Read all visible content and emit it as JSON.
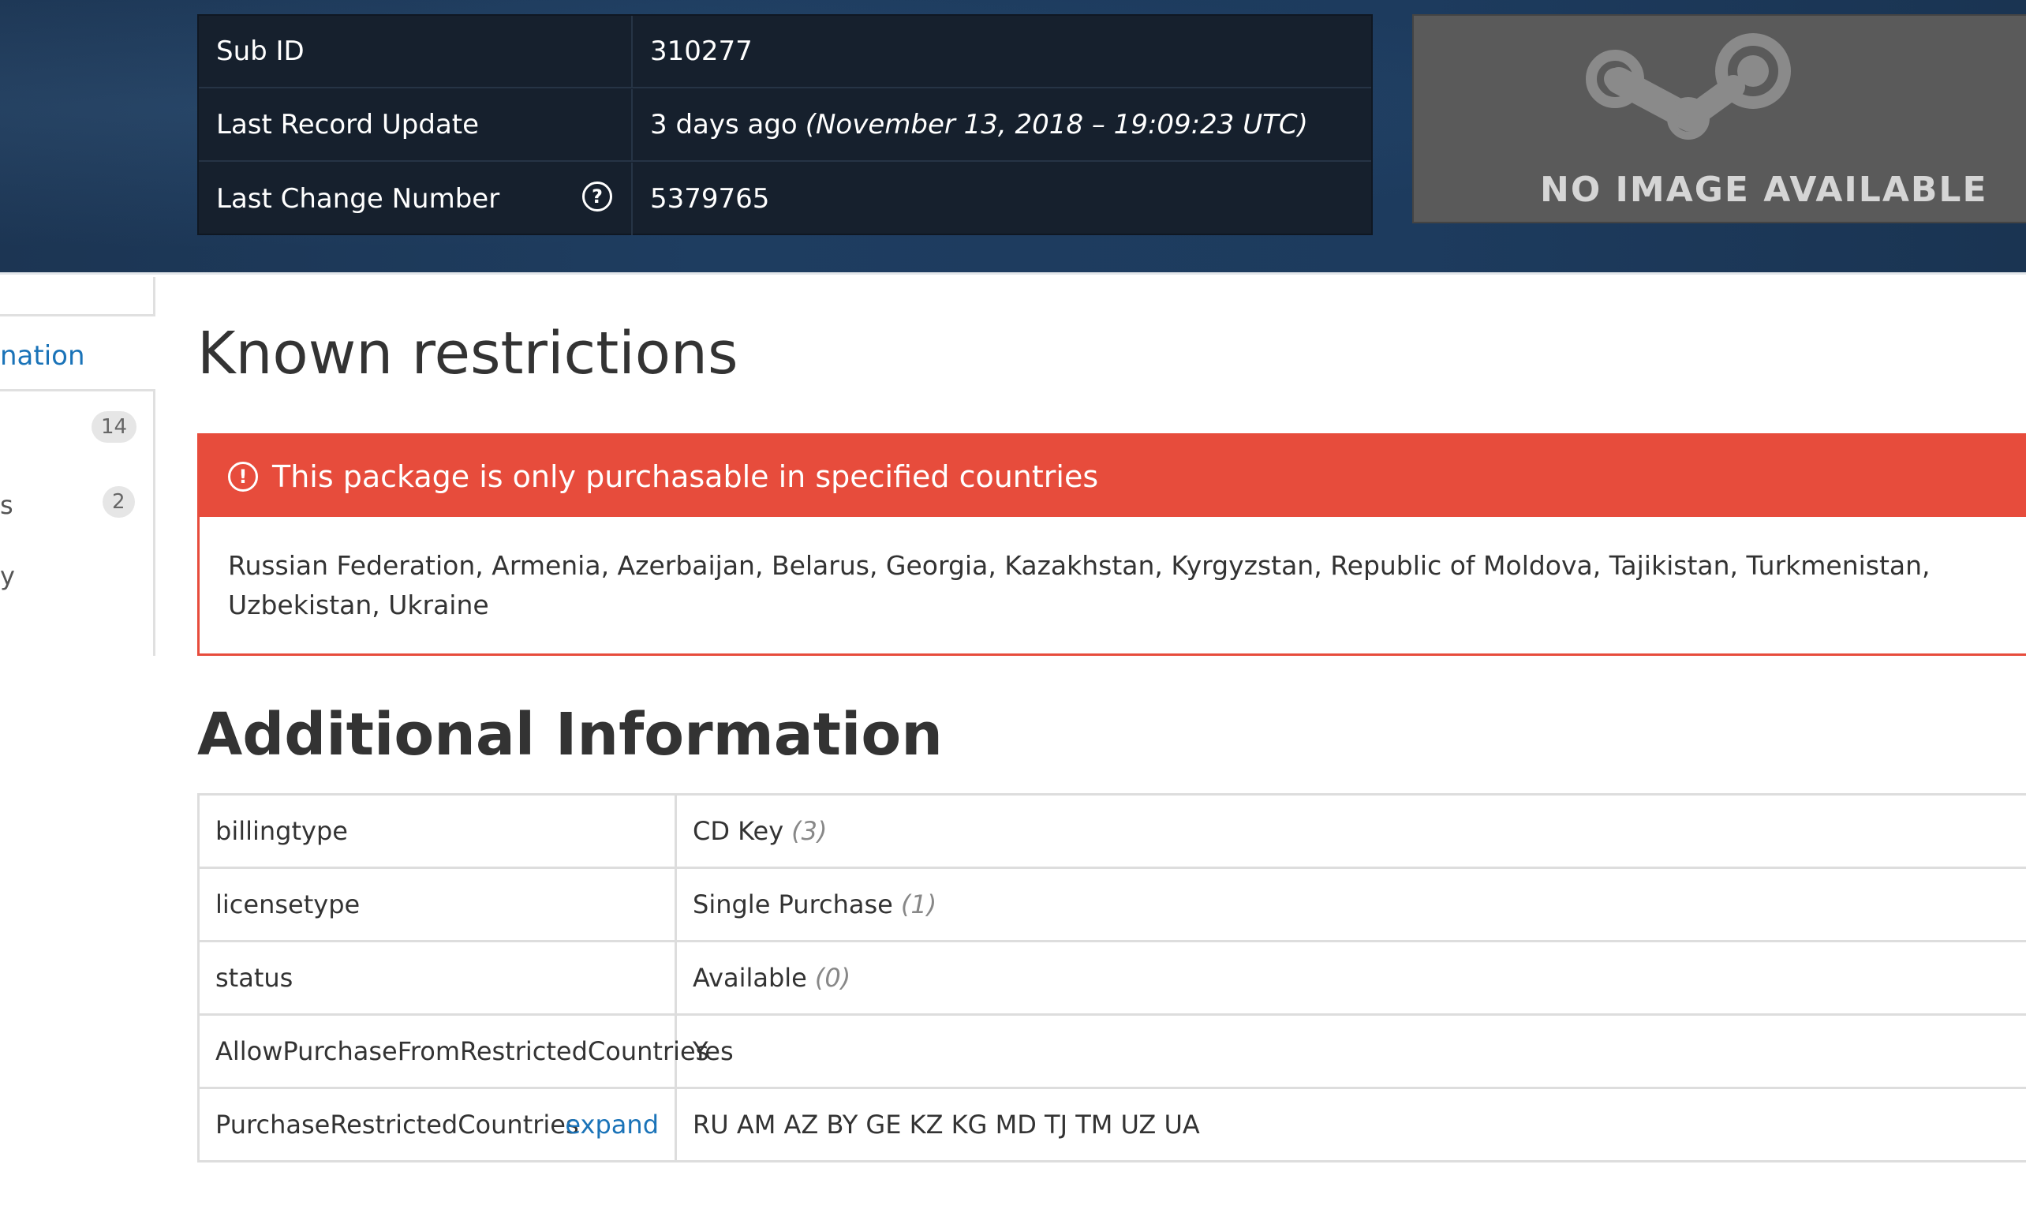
{
  "info": {
    "sub_id_label": "Sub ID",
    "sub_id_value": "310277",
    "last_update_label": "Last Record Update",
    "last_update_value": "3 days ago",
    "last_update_exact": "(November 13, 2018 – 19:09:23 UTC)",
    "last_change_label": "Last Change Number",
    "last_change_value": "5379765"
  },
  "image_placeholder": {
    "text": "NO IMAGE AVAILABLE",
    "logo": "steam-logo"
  },
  "sidebar": {
    "link_fragment": "nation",
    "items": [
      {
        "label": "",
        "count": "14"
      },
      {
        "label": "s",
        "count": "2"
      },
      {
        "label": "y",
        "count": ""
      }
    ]
  },
  "restrictions": {
    "heading": "Known restrictions",
    "alert_title": "This package is only purchasable in specified countries",
    "alert_icon": "exclamation-circle-icon",
    "countries": "Russian Federation, Armenia, Azerbaijan, Belarus, Georgia, Kazakhstan, Kyrgyzstan, Republic of Moldova, Tajikistan, Turkmenistan, Uzbekistan, Ukraine"
  },
  "additional": {
    "heading": "Additional Information",
    "rows": [
      {
        "key": "billingtype",
        "value": "CD Key",
        "code": "(3)"
      },
      {
        "key": "licensetype",
        "value": "Single Purchase",
        "code": "(1)"
      },
      {
        "key": "status",
        "value": "Available",
        "code": "(0)"
      },
      {
        "key": "AllowPurchaseFromRestrictedCountries",
        "value": "Yes",
        "code": ""
      },
      {
        "key": "PurchaseRestrictedCountries",
        "value": "RU AM AZ BY GE KZ KG MD TJ TM UZ UA",
        "code": "",
        "action": "expand"
      }
    ]
  },
  "colors": {
    "alert_red": "#e74c3c",
    "link_blue": "#1a73b8",
    "hero_bg": "#1e3d60",
    "info_table_bg": "#16202d"
  }
}
